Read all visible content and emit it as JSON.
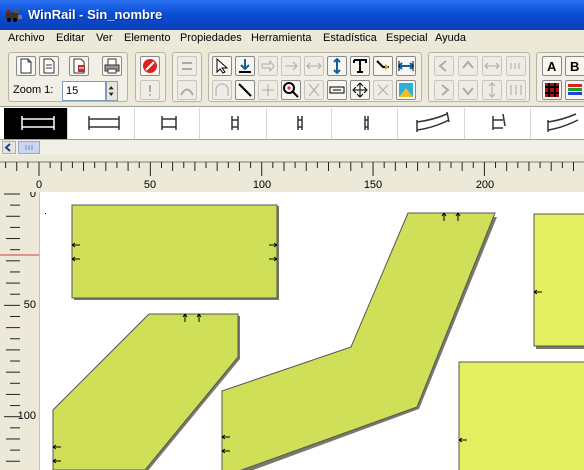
{
  "window": {
    "title": "WinRail - Sin_nombre"
  },
  "menu": [
    "Archivo",
    "Editar",
    "Ver",
    "Elemento",
    "Propiedades",
    "Herramienta",
    "Estadística",
    "Especial",
    "Ayuda"
  ],
  "toolbar": {
    "zoom_label": "Zoom 1:",
    "zoom_value": "15"
  },
  "ruler": {
    "unit_ticks_x": [
      "0",
      "50",
      "100",
      "150",
      "200"
    ],
    "unit_ticks_y": [
      "0",
      "50",
      "100"
    ]
  },
  "colors": {
    "piece_fill": "#cfdf58",
    "piece_fill_light": "#e4f060",
    "selection": "#000000",
    "titlebar": "#0a4fd6",
    "marker": "#d04040"
  },
  "icons": {
    "app": "locomotive-icon",
    "toolbar": [
      "new-document-icon",
      "open-document-icon",
      "save-icon",
      "print-icon",
      "stop-icon",
      "select-arrow-icon",
      "insert-track-icon",
      "measure-icon",
      "zoom-icon",
      "line-icon",
      "text-icon",
      "rotate-icon",
      "flip-icon",
      "color-fill-icon",
      "letter-a-icon",
      "letter-b-icon",
      "grid-icon",
      "layers-icon"
    ]
  }
}
